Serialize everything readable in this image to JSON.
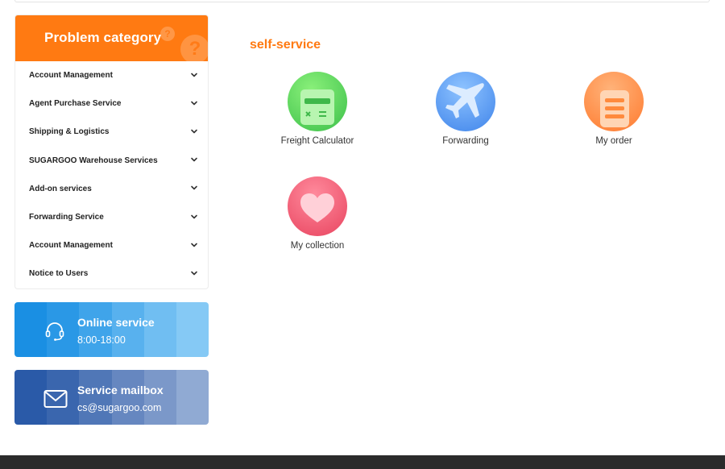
{
  "sidebar": {
    "category_title": "Problem category",
    "items": [
      {
        "label": "Account Management"
      },
      {
        "label": "Agent Purchase Service"
      },
      {
        "label": "Shipping & Logistics"
      },
      {
        "label": "SUGARGOO Warehouse Services"
      },
      {
        "label": "Add-on services"
      },
      {
        "label": "Forwarding Service"
      },
      {
        "label": "Account Management"
      },
      {
        "label": "Notice to Users"
      }
    ],
    "online_service": {
      "title": "Online service",
      "subtitle": "8:00-18:00",
      "icon": "headset-icon"
    },
    "service_mailbox": {
      "title": "Service mailbox",
      "subtitle": "cs@sugargoo.com",
      "icon": "mail-icon"
    }
  },
  "main": {
    "title": "self-service",
    "tiles": [
      {
        "label": "Freight Calculator",
        "icon": "calculator-icon",
        "color": "#4cd35a"
      },
      {
        "label": "Forwarding",
        "icon": "airplane-icon",
        "color": "#4a90f0"
      },
      {
        "label": "My order",
        "icon": "order-list-icon",
        "color": "#ff8a3d"
      },
      {
        "label": "My collection",
        "icon": "heart-icon",
        "color": "#f04a6a"
      }
    ]
  },
  "colors": {
    "accent": "#ff7a12",
    "online_service_bg": "#1a8fe3",
    "mailbox_bg": "#2a5db0",
    "footer": "#2b2b2b"
  }
}
